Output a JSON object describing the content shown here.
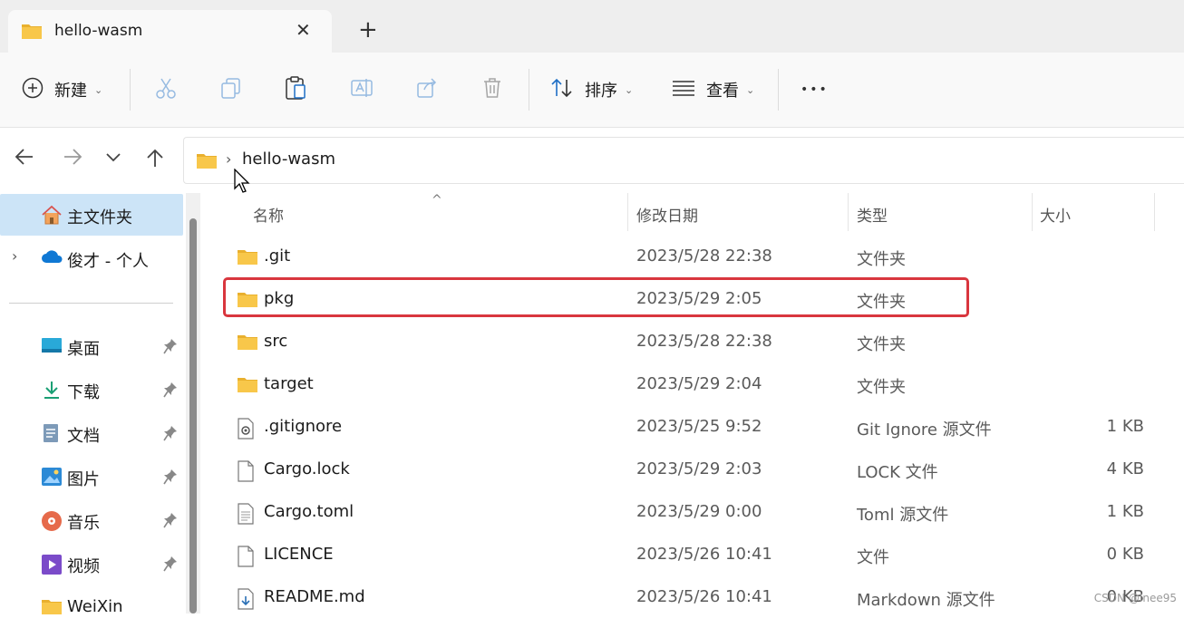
{
  "window": {
    "tab_title": "hello-wasm",
    "tab_close": "✕",
    "new_tab": "+"
  },
  "toolbar": {
    "new_label": "新建",
    "sort_label": "排序",
    "view_label": "查看",
    "more_label": "•••",
    "caret": "⌄"
  },
  "address": {
    "separator": "›",
    "path": "hello-wasm"
  },
  "sidebar": {
    "items": [
      {
        "label": "主文件夹",
        "icon": "home-icon"
      },
      {
        "label": "俊才 - 个人",
        "icon": "onedrive-icon"
      },
      {
        "label": "桌面",
        "icon": "desktop-icon"
      },
      {
        "label": "下载",
        "icon": "download-icon"
      },
      {
        "label": "文档",
        "icon": "document-icon"
      },
      {
        "label": "图片",
        "icon": "pictures-icon"
      },
      {
        "label": "音乐",
        "icon": "music-icon"
      },
      {
        "label": "视频",
        "icon": "video-icon"
      },
      {
        "label": "WeiXin",
        "icon": "folder-icon"
      }
    ],
    "expander": "›"
  },
  "columns": {
    "name": "名称",
    "date": "修改日期",
    "type": "类型",
    "size": "大小",
    "sort_indicator": "^"
  },
  "files": [
    {
      "name": ".git",
      "date": "2023/5/28 22:38",
      "type": "文件夹",
      "size": "",
      "icon": "folder-icon"
    },
    {
      "name": "pkg",
      "date": "2023/5/29 2:05",
      "type": "文件夹",
      "size": "",
      "icon": "folder-icon"
    },
    {
      "name": "src",
      "date": "2023/5/28 22:38",
      "type": "文件夹",
      "size": "",
      "icon": "folder-icon"
    },
    {
      "name": "target",
      "date": "2023/5/29 2:04",
      "type": "文件夹",
      "size": "",
      "icon": "folder-icon"
    },
    {
      "name": ".gitignore",
      "date": "2023/5/25 9:52",
      "type": "Git Ignore 源文件",
      "size": "1 KB",
      "icon": "config-file-icon"
    },
    {
      "name": "Cargo.lock",
      "date": "2023/5/29 2:03",
      "type": "LOCK 文件",
      "size": "4 KB",
      "icon": "file-icon"
    },
    {
      "name": "Cargo.toml",
      "date": "2023/5/29 0:00",
      "type": "Toml 源文件",
      "size": "1 KB",
      "icon": "text-file-icon"
    },
    {
      "name": "LICENCE",
      "date": "2023/5/26 10:41",
      "type": "文件",
      "size": "0 KB",
      "icon": "file-icon"
    },
    {
      "name": "README.md",
      "date": "2023/5/26 10:41",
      "type": "Markdown 源文件",
      "size": "0 KB",
      "icon": "markdown-file-icon"
    }
  ],
  "watermark": "CSDN @Inee95",
  "colors": {
    "accent": "#0067c0",
    "selection": "#cce4f7",
    "highlight_border": "#d9363e",
    "folder": "#f8c74a"
  }
}
